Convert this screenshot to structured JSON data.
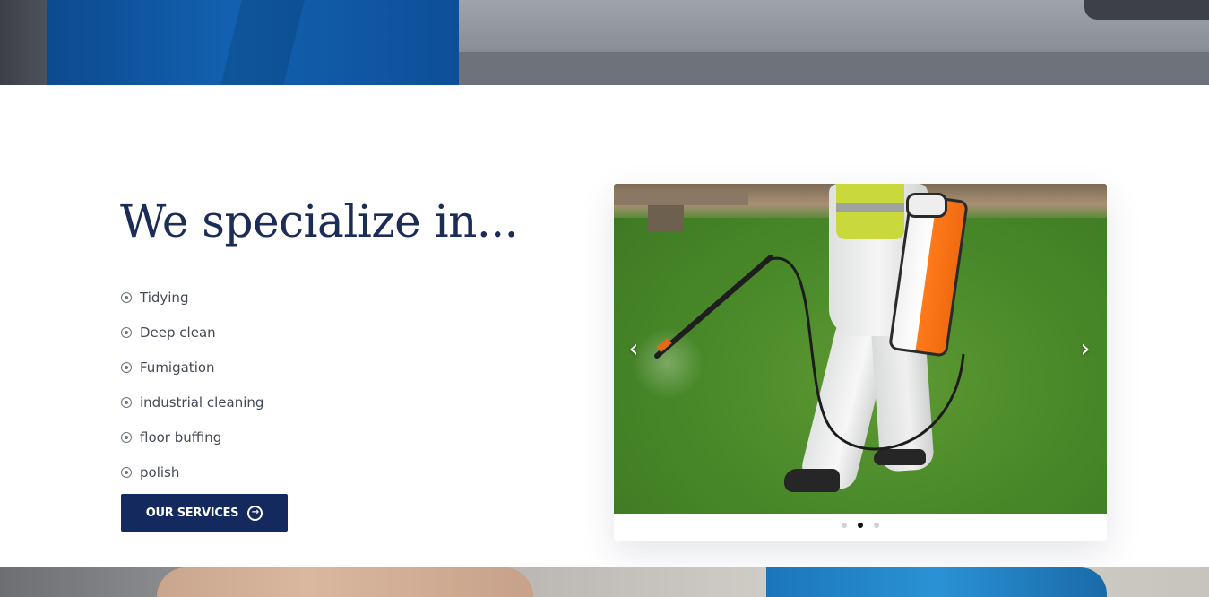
{
  "specialize": {
    "heading": "We specialize in...",
    "services": [
      "Tidying",
      "Deep clean",
      "Fumigation",
      "industrial cleaning",
      "floor buffing",
      "polish"
    ],
    "button_label": "OUR SERVICES",
    "button_icon": "arrow-circle-right-icon"
  },
  "carousel": {
    "prev_glyph": "‹",
    "next_glyph": "›",
    "slide_count": 3,
    "active_index": 1,
    "image_subject": "worker in protective suit spraying lawn with backpack sprayer"
  },
  "colors": {
    "heading": "#1b2c57",
    "button_bg": "#14295d",
    "text": "#444a55",
    "dot_active": "#111111",
    "dot_inactive": "#cfd2d8"
  }
}
